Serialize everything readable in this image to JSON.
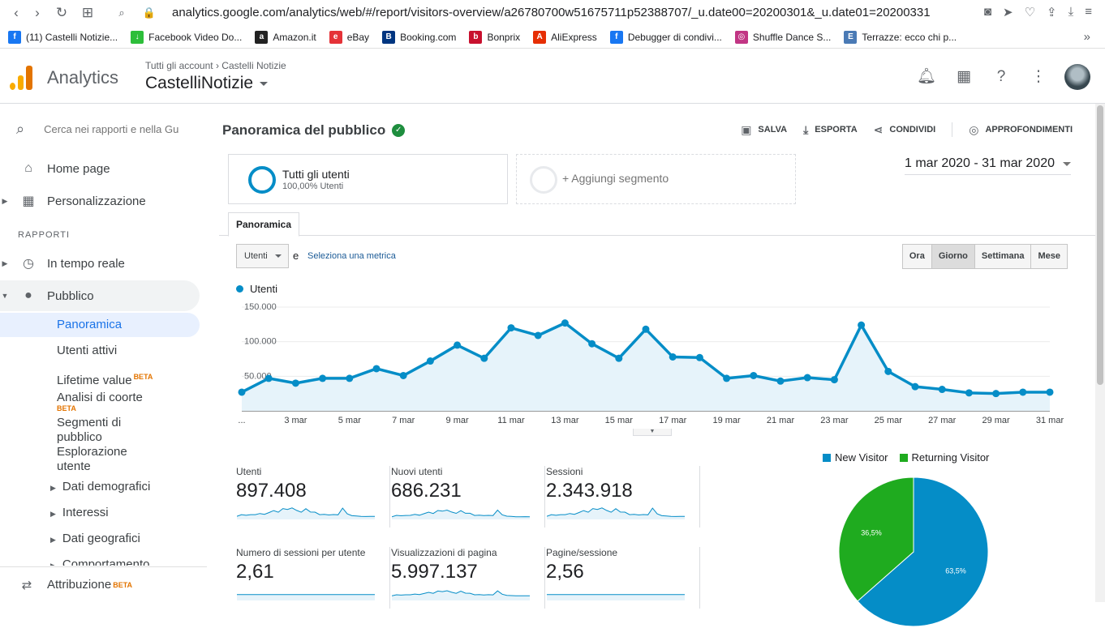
{
  "browser": {
    "url": "analytics.google.com/analytics/web/#/report/visitors-overview/a26780700w51675711p52388707/_u.date00=20200301&_u.date01=20200331",
    "bookmarks": [
      {
        "label": "(11) Castelli Notizie...",
        "color": "#1877f2",
        "glyph": "f"
      },
      {
        "label": "Facebook Video Do...",
        "color": "#2dbe3a",
        "glyph": "↓"
      },
      {
        "label": "Amazon.it",
        "color": "#222222",
        "glyph": "a"
      },
      {
        "label": "eBay",
        "color": "#e53238",
        "glyph": "e"
      },
      {
        "label": "Booking.com",
        "color": "#003580",
        "glyph": "B"
      },
      {
        "label": "Bonprix",
        "color": "#c8102e",
        "glyph": "b"
      },
      {
        "label": "AliExpress",
        "color": "#e62e04",
        "glyph": "A"
      },
      {
        "label": "Debugger di condivi...",
        "color": "#1877f2",
        "glyph": "f"
      },
      {
        "label": "Shuffle Dance S...",
        "color": "#c13584",
        "glyph": "◎"
      },
      {
        "label": "Terrazze: ecco chi p...",
        "color": "#4a7ab5",
        "glyph": "E"
      }
    ]
  },
  "header": {
    "app_name": "Analytics",
    "breadcrumb_account": "Tutti gli account",
    "breadcrumb_property": "Castelli Notizie",
    "property": "CastelliNotizie"
  },
  "sidebar": {
    "search_placeholder": "Cerca nei rapporti e nella Gu",
    "home": "Home page",
    "custom": "Personalizzazione",
    "section": "RAPPORTI",
    "realtime": "In tempo reale",
    "audience": "Pubblico",
    "overview": "Panoramica",
    "active_users": "Utenti attivi",
    "lifetime": "Lifetime value",
    "cohort": "Analisi di coorte",
    "beta": "BETA",
    "segments": "Segmenti di pubblico",
    "explorer": "Esplorazione utente",
    "demographics": "Dati demografici",
    "interests": "Interessi",
    "geo": "Dati geografici",
    "behavior": "Comportamento",
    "attribution": "Attribuzione"
  },
  "report": {
    "title": "Panoramica del pubblico",
    "actions": {
      "save": "SALVA",
      "export": "ESPORTA",
      "share": "CONDIVIDI",
      "insights": "APPROFONDIMENTI"
    },
    "segment_name": "Tutti gli utenti",
    "segment_sub": "100,00% Utenti",
    "add_segment": "+ Aggiungi segmento",
    "date_range": "1 mar 2020 - 31 mar 2020",
    "tab": "Panoramica",
    "metric_select": "Utenti",
    "metric_and": "e",
    "metric_link": "Seleziona una metrica",
    "granularity": [
      "Ora",
      "Giorno",
      "Settimana",
      "Mese"
    ],
    "granularity_selected": "Giorno",
    "legend": "Utenti",
    "metrics": [
      {
        "label": "Utenti",
        "value": "897.408"
      },
      {
        "label": "Nuovi utenti",
        "value": "686.231"
      },
      {
        "label": "Sessioni",
        "value": "2.343.918"
      },
      {
        "label": "Numero di sessioni per utente",
        "value": "2,61"
      },
      {
        "label": "Visualizzazioni di pagina",
        "value": "5.997.137"
      },
      {
        "label": "Pagine/sessione",
        "value": "2,56"
      }
    ]
  },
  "chart_data": [
    {
      "type": "area",
      "series": [
        {
          "name": "Utenti",
          "color": "#058dc7",
          "values": [
            27000,
            47000,
            40000,
            47000,
            47000,
            61000,
            51000,
            72000,
            95000,
            76000,
            120000,
            109000,
            127000,
            97000,
            76000,
            118000,
            78000,
            77000,
            47000,
            51000,
            43000,
            48000,
            45000,
            124000,
            57000,
            35000,
            31000,
            26000,
            25000,
            27000,
            27000
          ]
        }
      ],
      "x": [
        "1 mar",
        "2 mar",
        "3 mar",
        "4 mar",
        "5 mar",
        "6 mar",
        "7 mar",
        "8 mar",
        "9 mar",
        "10 mar",
        "11 mar",
        "12 mar",
        "13 mar",
        "14 mar",
        "15 mar",
        "16 mar",
        "17 mar",
        "18 mar",
        "19 mar",
        "20 mar",
        "21 mar",
        "22 mar",
        "23 mar",
        "24 mar",
        "25 mar",
        "26 mar",
        "27 mar",
        "28 mar",
        "29 mar",
        "30 mar",
        "31 mar"
      ],
      "x_tick_labels": [
        "...",
        "3 mar",
        "5 mar",
        "7 mar",
        "9 mar",
        "11 mar",
        "13 mar",
        "15 mar",
        "17 mar",
        "19 mar",
        "21 mar",
        "23 mar",
        "25 mar",
        "27 mar",
        "29 mar",
        "31 mar"
      ],
      "y_tick_labels": [
        "150.000",
        "100.000",
        "50.000"
      ],
      "ylim": [
        0,
        150000
      ],
      "grid": true
    },
    {
      "type": "pie",
      "categories": [
        "New Visitor",
        "Returning Visitor"
      ],
      "values": [
        63.5,
        36.5
      ],
      "labels": [
        "63,5%",
        "36,5%"
      ],
      "colors": [
        "#058dc7",
        "#1fab1f"
      ]
    }
  ]
}
